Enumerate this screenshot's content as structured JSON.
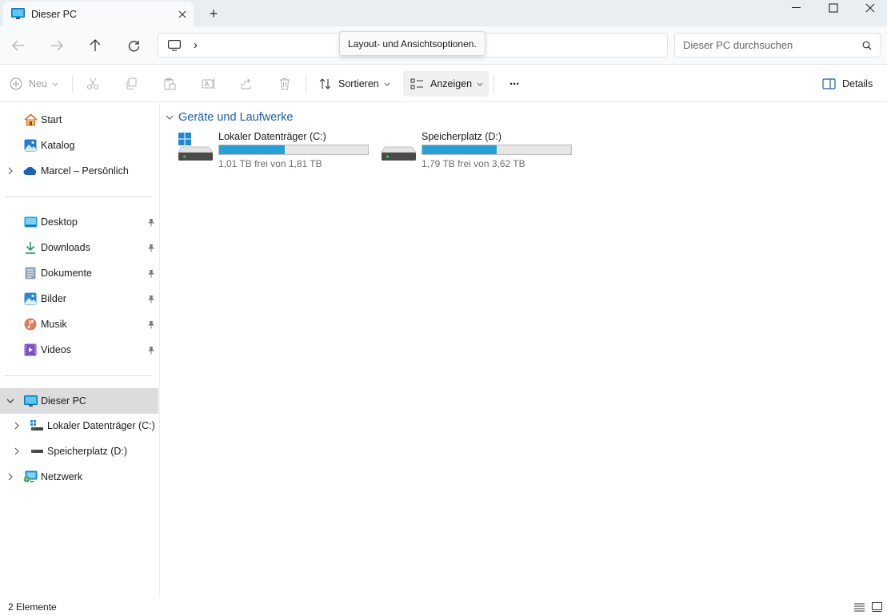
{
  "window": {
    "tab_title": "Dieser PC",
    "new_tab_symbol": "+"
  },
  "address": {
    "breadcrumb_separator": "›"
  },
  "search": {
    "placeholder": "Dieser PC durchsuchen"
  },
  "tooltip": {
    "text": "Layout- und Ansichtsoptionen."
  },
  "toolbar": {
    "new_label": "Neu",
    "sort_label": "Sortieren",
    "view_label": "Anzeigen",
    "more_label": "···",
    "details_label": "Details"
  },
  "sidebar": {
    "quick": [
      {
        "label": "Start",
        "icon": "home-icon"
      },
      {
        "label": "Katalog",
        "icon": "gallery-icon"
      },
      {
        "label": "Marcel – Persönlich",
        "icon": "onedrive-icon"
      }
    ],
    "pinned": [
      {
        "label": "Desktop",
        "icon": "desktop-icon"
      },
      {
        "label": "Downloads",
        "icon": "download-icon"
      },
      {
        "label": "Dokumente",
        "icon": "document-icon"
      },
      {
        "label": "Bilder",
        "icon": "pictures-icon"
      },
      {
        "label": "Musik",
        "icon": "music-icon"
      },
      {
        "label": "Videos",
        "icon": "videos-icon"
      }
    ],
    "tree": [
      {
        "label": "Dieser PC",
        "icon": "computer-icon"
      },
      {
        "label": "Lokaler Datenträger (C:)",
        "icon": "system-drive-icon"
      },
      {
        "label": "Speicherplatz (D:)",
        "icon": "drive-icon"
      },
      {
        "label": "Netzwerk",
        "icon": "network-icon"
      }
    ]
  },
  "content": {
    "group_title": "Geräte und Laufwerke",
    "drives": [
      {
        "name": "Lokaler Datenträger (C:)",
        "free_text": "1,01 TB frei von 1,81 TB",
        "used_fraction": 0.44
      },
      {
        "name": "Speicherplatz (D:)",
        "free_text": "1,79 TB frei von 3,62 TB",
        "used_fraction": 0.5
      }
    ]
  },
  "status": {
    "count": "2 Elemente"
  },
  "colors": {
    "accent": "#1c5faa",
    "drive_fill": "#26a0da",
    "selected_bg": "#dcdcdc"
  }
}
